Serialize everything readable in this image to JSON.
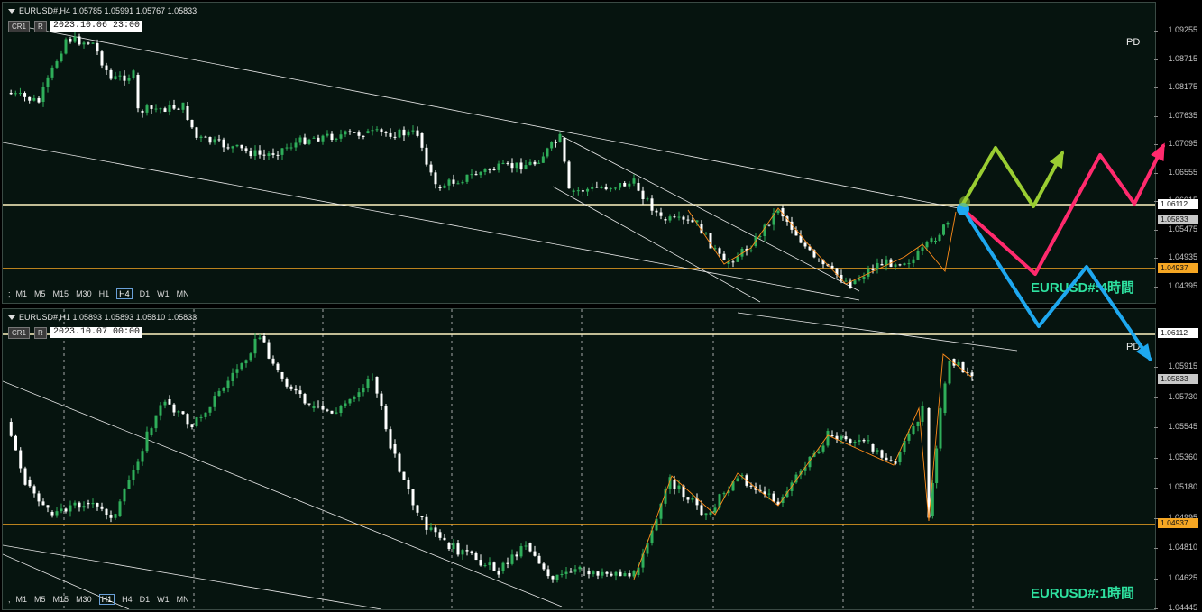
{
  "top": {
    "header": "EURUSD#,H4  1.05785 1.05991 1.05767 1.05833",
    "btn_cr": "CR1",
    "btn_r": "R",
    "date": "2023.10.06 23:00",
    "pd": "PD",
    "timeframes": [
      "M1",
      "M5",
      "M15",
      "M30",
      "H1",
      "H4",
      "D1",
      "W1",
      "MN"
    ],
    "active_tf": "H4",
    "y_labels": [
      "1.09255",
      "1.08715",
      "1.08175",
      "1.07635",
      "1.07095",
      "1.06555",
      "1.06015",
      "1.05475",
      "1.04935",
      "1.04395"
    ],
    "tags": {
      "upper": "1.06112",
      "current": "1.05833",
      "lower": "1.04937"
    },
    "caption": "EURUSD#:4時間"
  },
  "bottom": {
    "header": "EURUSD#,H1  1.05893 1.05893 1.05810 1.05833",
    "btn_cr": "CR1",
    "btn_r": "R",
    "date": "2023.10.07 00:00",
    "pd": "PD",
    "timeframes": [
      "M1",
      "M5",
      "M15",
      "M30",
      "H1",
      "H4",
      "D1",
      "W1",
      "MN"
    ],
    "active_tf": "H1",
    "y_labels": [
      "1.05915",
      "1.05730",
      "1.05545",
      "1.05360",
      "1.05180",
      "1.04995",
      "1.04810",
      "1.04625",
      "1.04445"
    ],
    "tags": {
      "upper": "1.06112",
      "current": "1.05833",
      "lower": "1.04937"
    },
    "caption": "EURUSD#:1時間"
  },
  "colors": {
    "bg": "#06140f",
    "up": "#2fae5a",
    "down": "#ffffff",
    "upper_line": "#fff4c2",
    "lower_line": "#f5a623",
    "green_arrow": "#9acd32",
    "pink_arrow": "#ff2a6d",
    "blue_arrow": "#1ea8f0"
  }
}
